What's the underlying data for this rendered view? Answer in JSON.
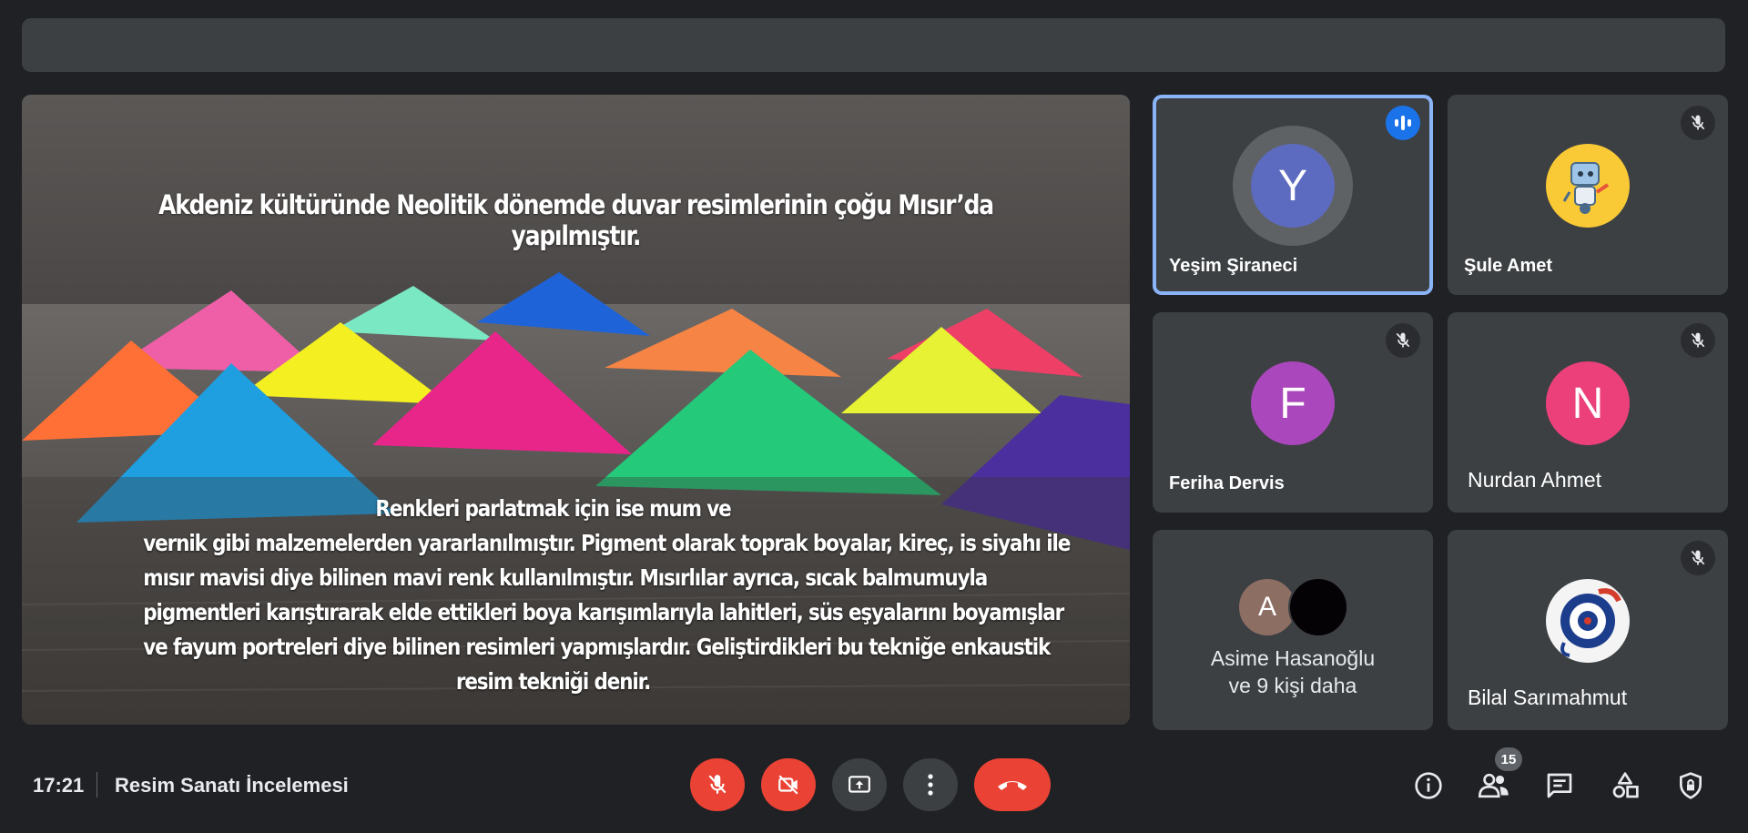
{
  "meeting": {
    "time": "17:21",
    "title": "Resim Sanatı İncelemesi",
    "participant_count": "15"
  },
  "slide": {
    "title": "Akdeniz kültüründe Neolitik dönemde duvar resimlerinin çoğu Mısır’da yapılmıştır.",
    "body_lines": [
      "Renkleri parlatmak için ise mum ve",
      "vernik gibi malzemelerden yararlanılmıştır. Pigment olarak toprak boyalar, kireç, is siyahı ile",
      "mısır mavisi diye bilinen mavi renk kullanılmıştır. Mısırlılar ayrıca, sıcak balmumuyla",
      "pigmentleri karıştırarak elde ettikleri boya karışımlarıyla lahitleri, süs eşyalarını boyamışlar",
      "ve fayum portreleri diye bilinen resimleri yapmışlardır. Geliştirdikleri bu tekniğe enkaustik",
      "resim tekniği denir."
    ]
  },
  "participants": [
    {
      "name": "Yeşim Şiraneci",
      "initial": "Y",
      "color": "#5c6bc0",
      "state": "speaking"
    },
    {
      "name": "Şule Amet",
      "avatar": "robot-avatar",
      "color": "#f9c936",
      "state": "muted"
    },
    {
      "name": "Feriha Dervis",
      "initial": "F",
      "color": "#ab47bc",
      "state": "muted"
    },
    {
      "name": "Nurdan Ahmet",
      "initial": "N",
      "color": "#ec407a",
      "state": "muted"
    },
    {
      "group_initial": "A",
      "group_color": "#8d6e63",
      "group_line1": "Asime Hasanoğlu",
      "group_line2": "ve 9 kişi daha"
    },
    {
      "name": "Bilal Sarımahmut",
      "avatar": "ornament-avatar",
      "state": "muted"
    }
  ],
  "colors": {
    "background": "#202124",
    "tile": "#3c4043",
    "red": "#ea4335",
    "active_border": "#8ab4f8",
    "accent": "#1a73e8"
  },
  "icons": {
    "mic": "mic-off-icon",
    "camera": "camera-off-icon",
    "present": "present-icon",
    "more": "more-vertical-icon",
    "hangup": "hang-up-icon",
    "info": "info-icon",
    "people": "people-icon",
    "chat": "chat-icon",
    "activities": "activities-icon",
    "host": "host-controls-icon"
  }
}
